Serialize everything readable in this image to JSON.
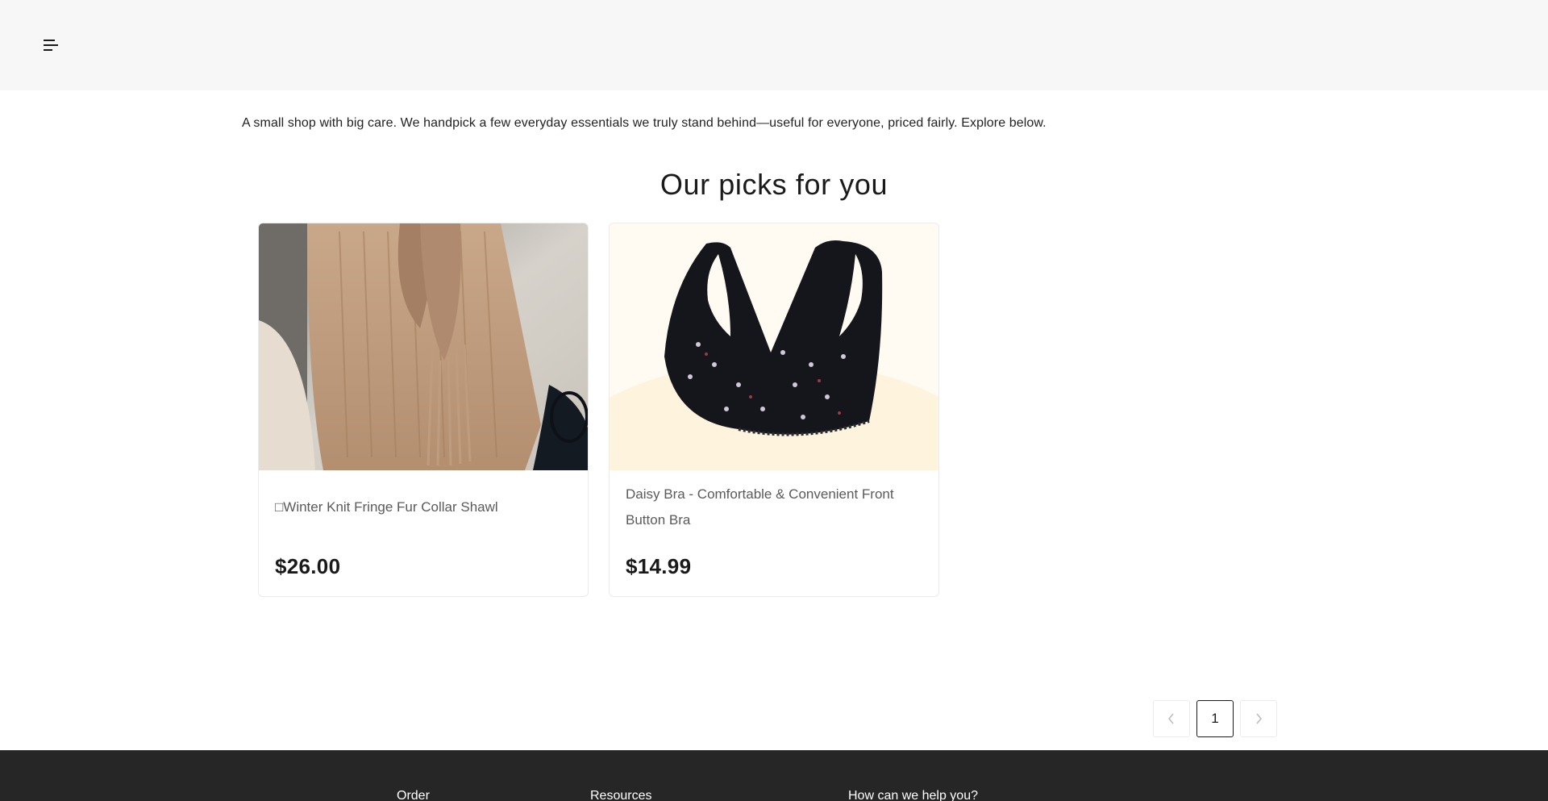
{
  "header": {
    "menu_icon": "hamburger-menu-icon"
  },
  "intro": {
    "text": "A small shop with big care. We handpick a few everyday essentials we truly stand behind—useful for everyone, priced fairly. Explore below."
  },
  "section": {
    "title": "Our picks for you"
  },
  "products": [
    {
      "title": "□Winter Knit Fringe Fur Collar Shawl",
      "price": "$26.00",
      "image": "beige-knit-shawl-photo"
    },
    {
      "title": "Daisy Bra - Comfortable & Convenient Front Button Bra",
      "price": "$14.99",
      "image": "black-floral-bra-photo"
    }
  ],
  "pagination": {
    "prev_icon": "chevron-left-icon",
    "current_page": "1",
    "next_icon": "chevron-right-icon"
  },
  "footer": {
    "columns": [
      "Order",
      "Resources",
      "How can we help you?"
    ]
  },
  "colors": {
    "header_bg": "#f7f7f7",
    "footer_bg": "#262626",
    "price_text": "#1a1a1a",
    "title_text": "#5a5a5a"
  }
}
